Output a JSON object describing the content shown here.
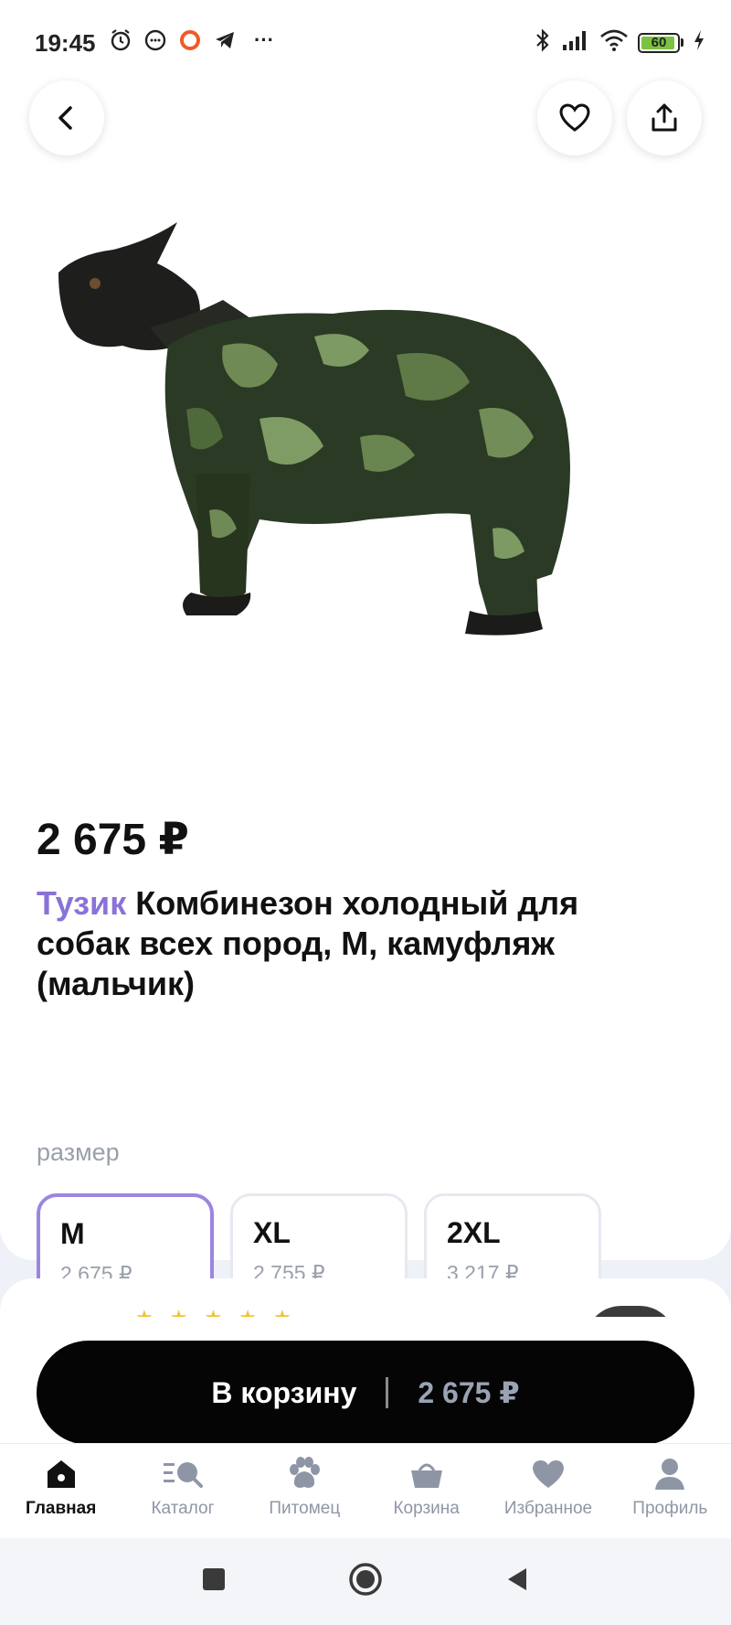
{
  "status_bar": {
    "time": "19:45",
    "left_icons": [
      "alarm-icon",
      "chat-icon",
      "ring-icon",
      "telegram-icon"
    ],
    "more": "···",
    "battery_percent": "60"
  },
  "product": {
    "price": "2 675 ₽",
    "brand": "Тузик",
    "title": "Комбинезон холодный для собак всех пород, М, камуфляж (мальчик)",
    "image_alt": "dog-in-camouflage-jumpsuit"
  },
  "sizes": {
    "label": "размер",
    "selected": "M",
    "options": [
      {
        "name": "M",
        "price": "2 675 ₽"
      },
      {
        "name": "XL",
        "price": "2 755 ₽"
      },
      {
        "name": "2XL",
        "price": "3 217 ₽"
      }
    ]
  },
  "review": {
    "stars_count": 5
  },
  "cart": {
    "label": "В корзину",
    "price": "2 675 ₽"
  },
  "nav": {
    "items": [
      {
        "label": "Главная",
        "icon": "home-icon",
        "active": true
      },
      {
        "label": "Каталог",
        "icon": "catalog-search-icon",
        "active": false
      },
      {
        "label": "Питомец",
        "icon": "paw-icon",
        "active": false
      },
      {
        "label": "Корзина",
        "icon": "basket-icon",
        "active": false
      },
      {
        "label": "Избранное",
        "icon": "heart-icon",
        "active": false
      },
      {
        "label": "Профиль",
        "icon": "profile-icon",
        "active": false
      }
    ]
  },
  "colors": {
    "accent": "#9b86e0",
    "brand_text": "#8a72d8",
    "cart_button": "#050505",
    "muted": "#9aa0ab",
    "star": "#f2c230"
  }
}
